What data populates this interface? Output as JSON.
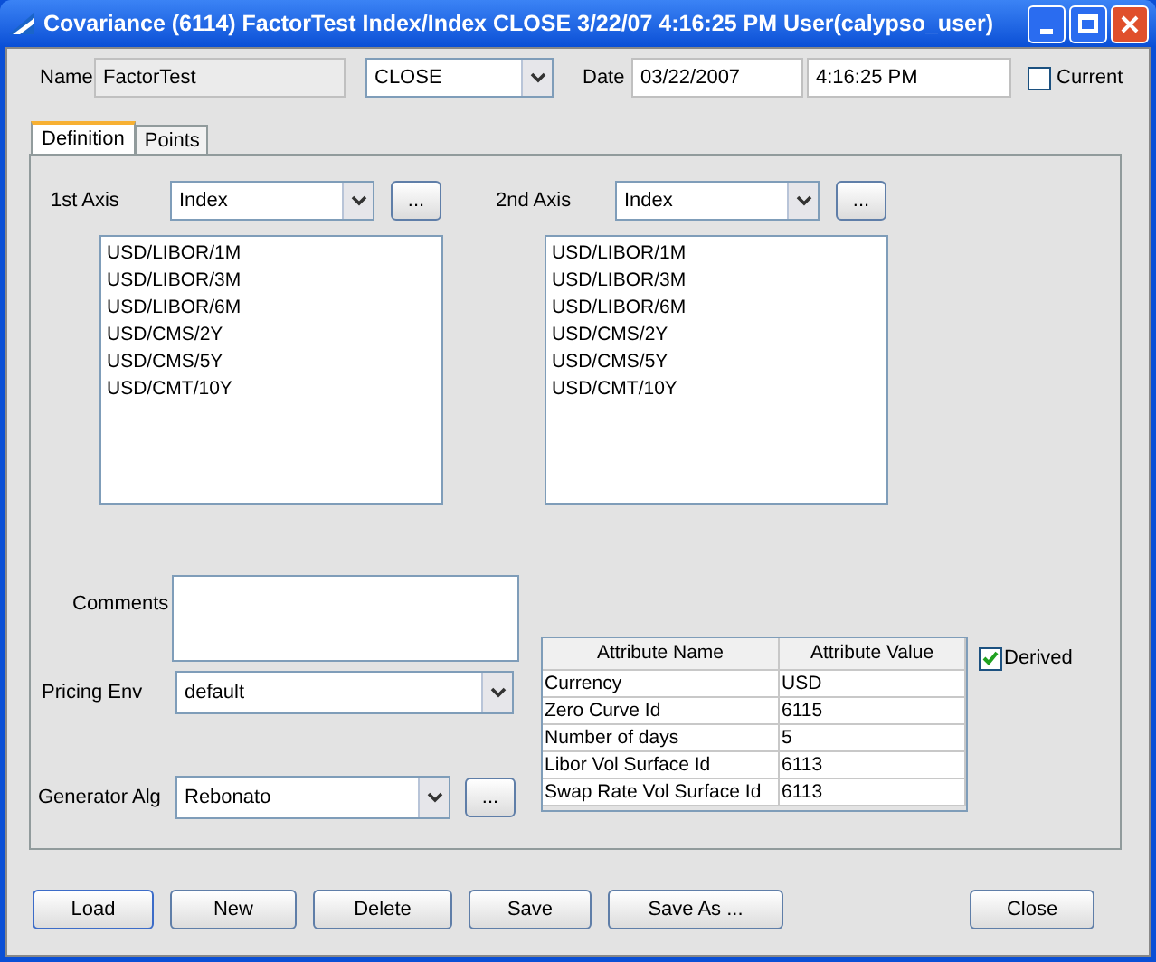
{
  "window": {
    "title": "Covariance (6114) FactorTest Index/Index CLOSE 3/22/07 4:16:25 PM User(calypso_user)"
  },
  "header": {
    "name_label": "Name",
    "name_value": "FactorTest",
    "env_value": "CLOSE",
    "date_label": "Date",
    "date_value": "03/22/2007",
    "time_value": "4:16:25 PM",
    "current": {
      "label": "Current",
      "checked": false
    }
  },
  "tabs": [
    {
      "label": "Definition",
      "selected": true
    },
    {
      "label": "Points",
      "selected": false
    }
  ],
  "axes": [
    {
      "label": "1st Axis",
      "value": "Index",
      "button": "...",
      "items": [
        "USD/LIBOR/1M",
        "USD/LIBOR/3M",
        "USD/LIBOR/6M",
        "USD/CMS/2Y",
        "USD/CMS/5Y",
        "USD/CMT/10Y"
      ]
    },
    {
      "label": "2nd Axis",
      "value": "Index",
      "button": "...",
      "items": [
        "USD/LIBOR/1M",
        "USD/LIBOR/3M",
        "USD/LIBOR/6M",
        "USD/CMS/2Y",
        "USD/CMS/5Y",
        "USD/CMT/10Y"
      ]
    }
  ],
  "comments": {
    "label": "Comments"
  },
  "pricing_env": {
    "label": "Pricing Env",
    "value": "default"
  },
  "generator_alg": {
    "label": "Generator Alg",
    "value": "Rebonato",
    "button": "..."
  },
  "attributes": {
    "columns": [
      "Attribute Name",
      "Attribute Value"
    ],
    "rows": [
      [
        "Currency",
        "USD"
      ],
      [
        "Zero Curve Id",
        "6115"
      ],
      [
        "Number of days",
        "5"
      ],
      [
        "Libor Vol Surface Id",
        "6113"
      ],
      [
        "Swap Rate Vol Surface Id",
        "6113"
      ]
    ]
  },
  "derived": {
    "label": "Derived",
    "checked": true
  },
  "buttons": [
    {
      "label": "Load",
      "focused": true
    },
    {
      "label": "New",
      "focused": false
    },
    {
      "label": "Delete",
      "focused": false
    },
    {
      "label": "Save",
      "focused": false
    },
    {
      "label": "Save As ...",
      "focused": false
    },
    {
      "label": "Close",
      "focused": false
    }
  ]
}
